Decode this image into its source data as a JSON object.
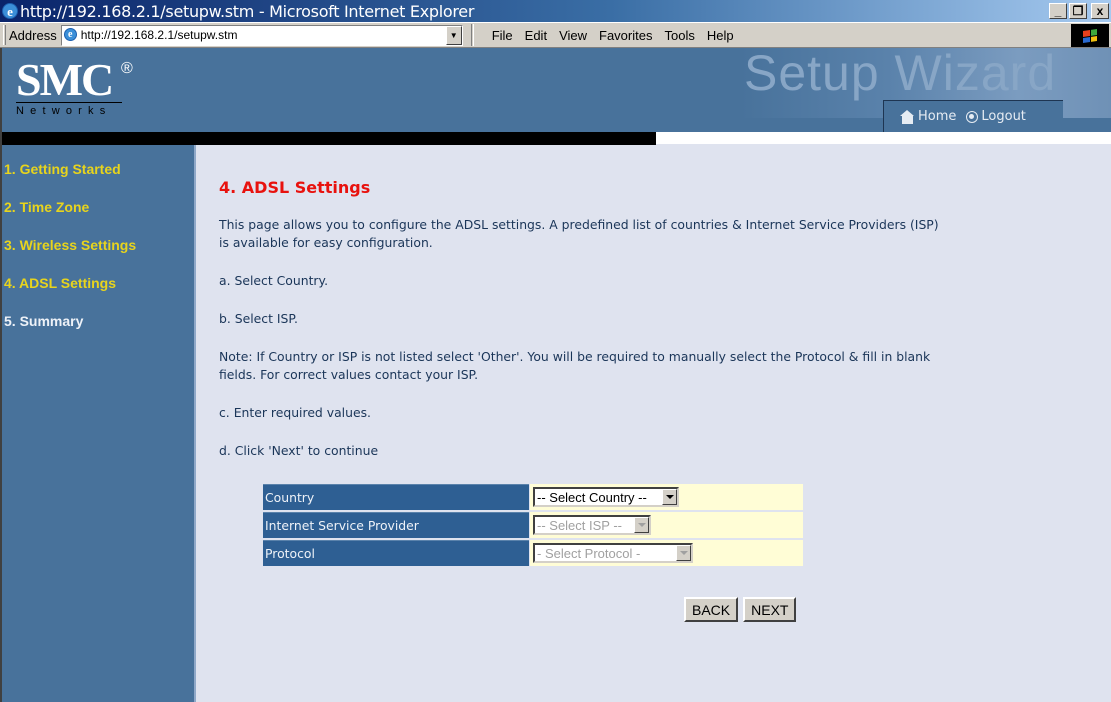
{
  "window": {
    "title": "http://192.168.2.1/setupw.stm - Microsoft Internet Explorer",
    "controls": {
      "minimize": "_",
      "restore": "❐",
      "close": "x"
    }
  },
  "toolbar": {
    "address_label": "Address",
    "address_value": "http://192.168.2.1/setupw.stm",
    "menu": [
      "File",
      "Edit",
      "View",
      "Favorites",
      "Tools",
      "Help"
    ]
  },
  "header": {
    "brand": "SMC",
    "registered": "®",
    "brand_sub": "Networks",
    "banner": "Setup Wizard",
    "home_label": "Home",
    "logout_label": "Logout"
  },
  "sidebar": {
    "items": [
      {
        "label": "1. Getting Started"
      },
      {
        "label": "2. Time Zone"
      },
      {
        "label": "3. Wireless Settings"
      },
      {
        "label": "4. ADSL Settings"
      },
      {
        "label": "5. Summary"
      }
    ]
  },
  "content": {
    "title": "4. ADSL Settings",
    "intro_line1": "This page allows you to configure the ADSL settings. A predefined list of countries & Internet Service Providers (ISP)",
    "intro_line2": "is available for easy configuration.",
    "step_a": "a. Select Country.",
    "step_b": "b. Select ISP.",
    "note_line1": "Note: If Country or ISP is not listed select 'Other'. You will be required to manually select the Protocol & fill in blank",
    "note_line2": "fields. For correct values contact your ISP.",
    "step_c": "c. Enter required values.",
    "step_d": "d. Click 'Next' to continue"
  },
  "form": {
    "rows": [
      {
        "label": "Country",
        "value": "-- Select Country --",
        "disabled": false
      },
      {
        "label": "Internet Service Provider",
        "value": "-- Select ISP --",
        "disabled": true
      },
      {
        "label": "Protocol",
        "value": "- Select Protocol -",
        "disabled": true
      }
    ],
    "back_label": "BACK",
    "next_label": "NEXT"
  }
}
